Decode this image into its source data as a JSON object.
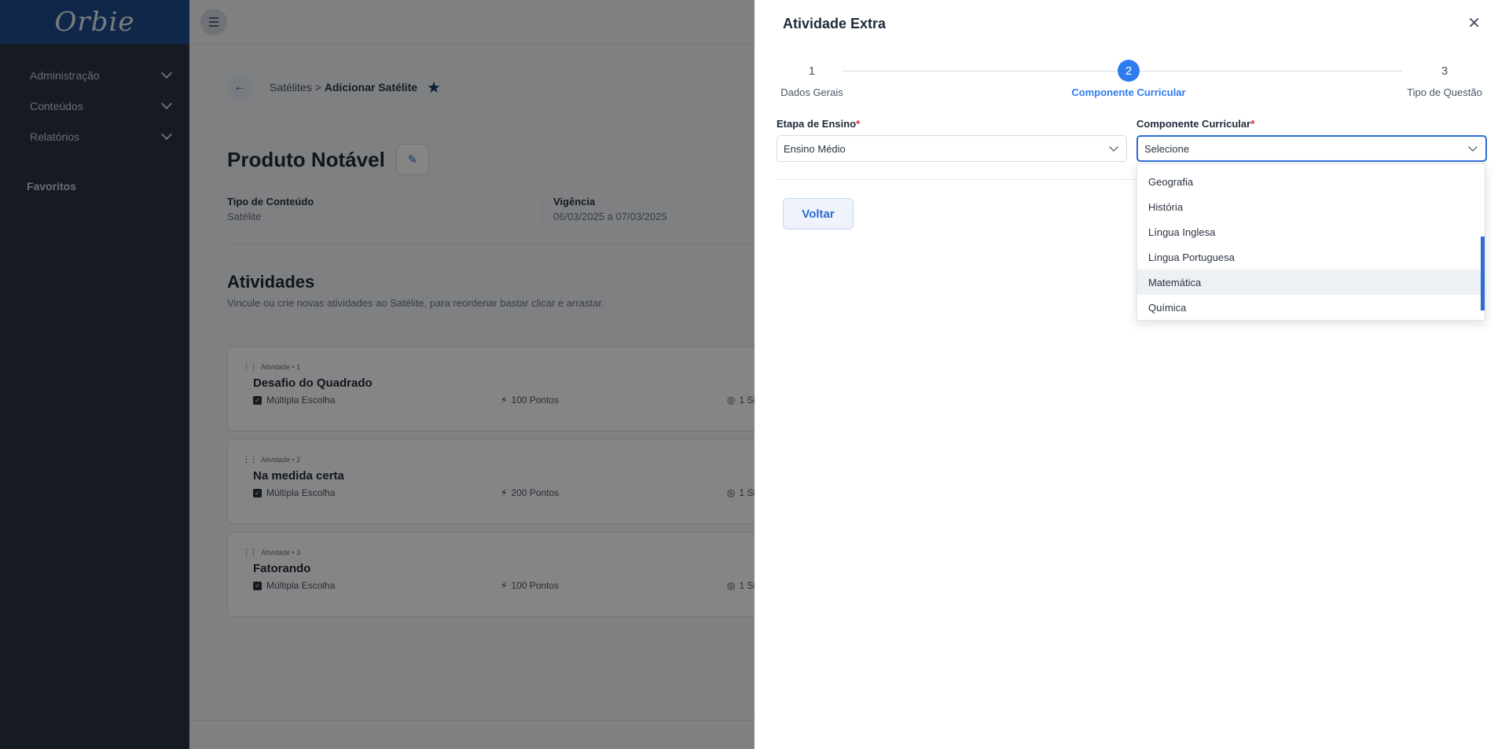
{
  "brand": {
    "logo_text": "Orbie"
  },
  "sidebar": {
    "items": [
      {
        "label": "Administração"
      },
      {
        "label": "Conteúdos"
      },
      {
        "label": "Relatórios"
      }
    ],
    "favorites_label": "Favoritos"
  },
  "breadcrumb": {
    "parent": "Satélites >",
    "current": "Adicionar Satélite"
  },
  "page": {
    "title": "Produto Notável",
    "meta": [
      {
        "label": "Tipo de Conteúdo",
        "value": "Satélite"
      },
      {
        "label": "Vigência",
        "value": "06/03/2025 a 07/03/2025"
      }
    ]
  },
  "activities": {
    "title": "Atividades",
    "subtitle": "Vincule ou crie novas atividades ao Satélite, para reordenar bastar clicar e arrastar.",
    "items": [
      {
        "tag": "Atividade • 1",
        "title": "Desafio do Quadrado",
        "type": "Múltipla Escolha",
        "points": "100 Pontos",
        "extra": "1 Si"
      },
      {
        "tag": "Atividade • 2",
        "title": "Na medida certa",
        "type": "Múltipla Escolha",
        "points": "200 Pontos",
        "extra": "1 Si"
      },
      {
        "tag": "Atividade • 3",
        "title": "Fatorando",
        "type": "Múltipla Escolha",
        "points": "100 Pontos",
        "extra": "1 Si"
      }
    ]
  },
  "drawer": {
    "title": "Atividade Extra",
    "steps": [
      {
        "num": "1",
        "label": "Dados Gerais"
      },
      {
        "num": "2",
        "label": "Componente Curricular"
      },
      {
        "num": "3",
        "label": "Tipo de Questão"
      }
    ],
    "fields": {
      "etapa": {
        "label": "Etapa de Ensino",
        "required": "*",
        "value": "Ensino Médio"
      },
      "componente": {
        "label": "Componente Curricular",
        "required": "*",
        "value": "Selecione"
      }
    },
    "dropdown_options": [
      "Geografia",
      "História",
      "Língua Inglesa",
      "Língua Portuguesa",
      "Matemática",
      "Química"
    ],
    "hovered_option": "Matemática",
    "back_button": "Voltar"
  },
  "colors": {
    "primary": "#2e7cf0",
    "sidebar": "#2b3441",
    "brand_bar": "#1d4d8c",
    "required": "#e02424"
  }
}
